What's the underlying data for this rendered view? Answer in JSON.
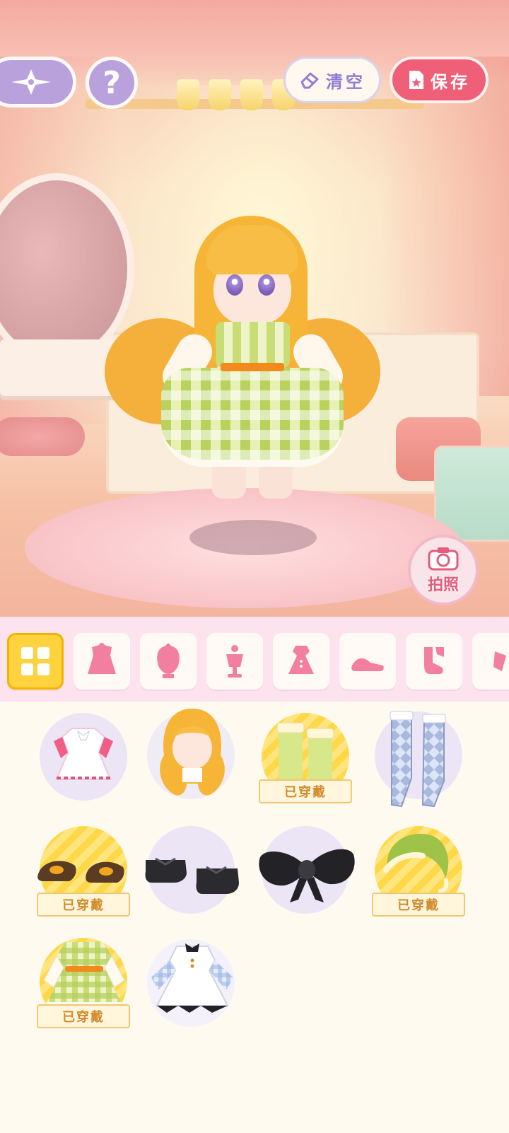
{
  "toolbar": {
    "nav_icon": "compass-star-icon",
    "help_label": "?",
    "clear_label": "清空",
    "save_label": "保存"
  },
  "photo": {
    "label": "拍照",
    "icon": "camera-icon"
  },
  "categories": [
    {
      "name": "all-icon",
      "active": true
    },
    {
      "name": "outfit-set-icon"
    },
    {
      "name": "hair-icon"
    },
    {
      "name": "accessory-icon"
    },
    {
      "name": "dress-icon"
    },
    {
      "name": "shoes-icon"
    },
    {
      "name": "socks-icon"
    },
    {
      "name": "more-icon"
    }
  ],
  "items": [
    {
      "name": "pink-dress",
      "worn": false,
      "badge": ""
    },
    {
      "name": "long-blonde-hair",
      "worn": false,
      "badge": ""
    },
    {
      "name": "green-stockings",
      "worn": true,
      "badge": "已穿戴"
    },
    {
      "name": "argyle-stockings",
      "worn": false,
      "badge": ""
    },
    {
      "name": "brown-shoes",
      "worn": true,
      "badge": "已穿戴"
    },
    {
      "name": "black-shoes",
      "worn": false,
      "badge": ""
    },
    {
      "name": "black-bow",
      "worn": false,
      "badge": ""
    },
    {
      "name": "green-bonnet",
      "worn": true,
      "badge": "已穿戴"
    },
    {
      "name": "gingham-dress",
      "worn": true,
      "badge": "已穿戴"
    },
    {
      "name": "maid-dress",
      "worn": false,
      "badge": ""
    }
  ],
  "colors": {
    "accent_pink": "#ef5f78",
    "accent_purple": "#b9a1dc",
    "worn_yellow": "#ffd84a"
  }
}
